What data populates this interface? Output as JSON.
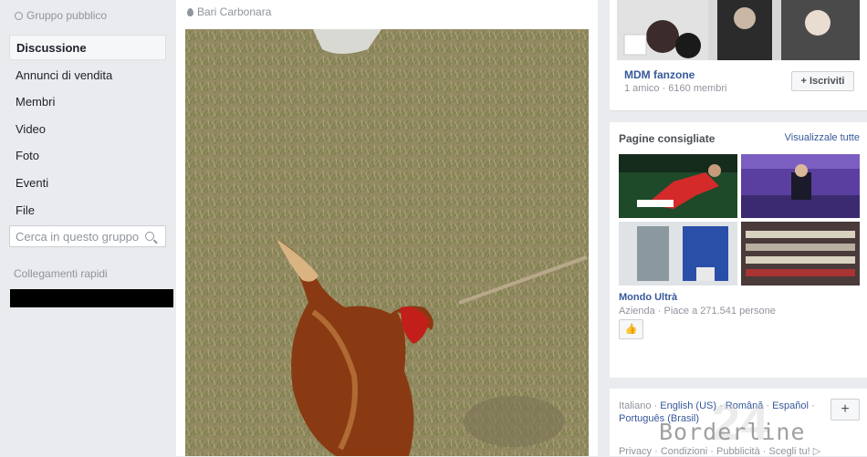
{
  "sidebar": {
    "group_type": "Gruppo pubblico",
    "items": [
      {
        "label": "Discussione"
      },
      {
        "label": "Annunci di vendita"
      },
      {
        "label": "Membri"
      },
      {
        "label": "Video"
      },
      {
        "label": "Foto"
      },
      {
        "label": "Eventi"
      },
      {
        "label": "File"
      }
    ],
    "search_placeholder": "Cerca in questo gruppo",
    "quick_links_title": "Collegamenti rapidi"
  },
  "post": {
    "location": "Bari Carbonara"
  },
  "group_card": {
    "name": "MDM fanzone",
    "meta": "1 amico · 6160 membri",
    "join_label": "+ Iscriviti"
  },
  "suggested_pages": {
    "title": "Pagine consigliate",
    "see_all": "Visualizzale tutte",
    "page_name": "Mondo Ultrà",
    "page_meta": "Azienda · Piace a 271.541 persone"
  },
  "languages": {
    "current": "Italiano",
    "list": [
      "English (US)",
      "Română",
      "Español",
      "Português (Brasil)"
    ],
    "add_label": "+"
  },
  "footer": {
    "links": [
      "Privacy",
      "Condizioni",
      "Pubblicità",
      "Scegli tu!"
    ]
  },
  "watermark": {
    "text": "Borderline",
    "number": "24"
  },
  "colors": {
    "link": "#365899",
    "muted": "#90949c",
    "background": "#e9ebee"
  }
}
